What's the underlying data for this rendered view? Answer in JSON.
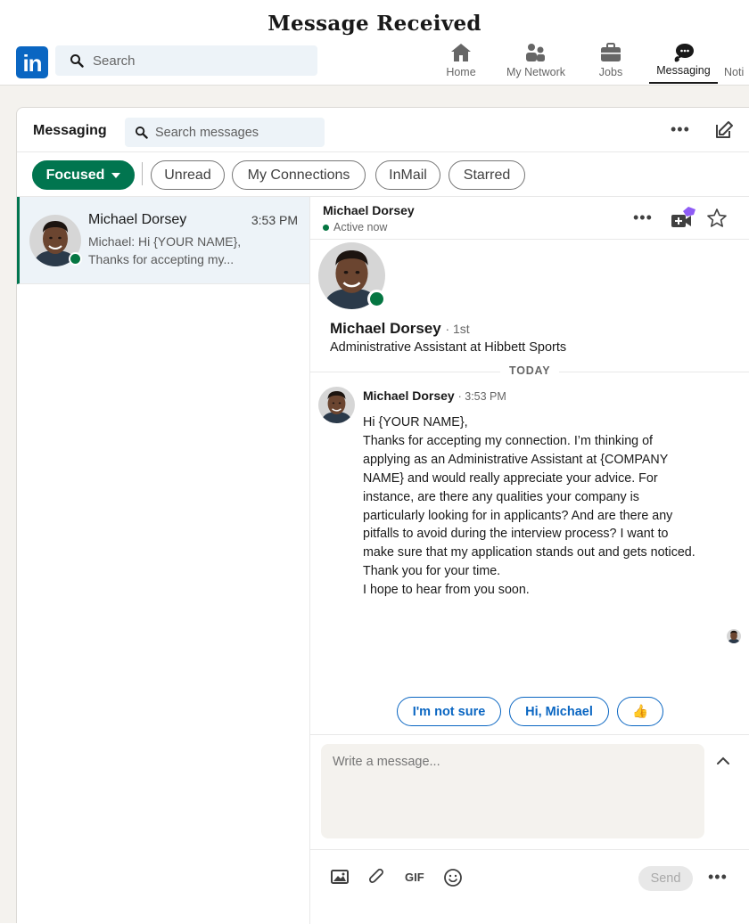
{
  "caption": "Message Received",
  "topnav": {
    "logo": "in",
    "search_placeholder": "Search",
    "items": [
      {
        "label": "Home",
        "icon": "home-icon"
      },
      {
        "label": "My Network",
        "icon": "network-icon"
      },
      {
        "label": "Jobs",
        "icon": "briefcase-icon"
      },
      {
        "label": "Messaging",
        "icon": "messaging-icon",
        "active": true
      },
      {
        "label": "Noti",
        "icon": "bell-icon"
      }
    ]
  },
  "messaging": {
    "title": "Messaging",
    "search_placeholder": "Search messages",
    "more": "•••",
    "filters": [
      "Focused",
      "Unread",
      "My Connections",
      "InMail",
      "Starred"
    ]
  },
  "conversation": {
    "name": "Michael Dorsey",
    "time": "3:53 PM",
    "preview": "Michael: Hi {YOUR NAME}, Thanks for accepting my..."
  },
  "thread": {
    "name": "Michael Dorsey",
    "status": "Active now",
    "more": "•••",
    "profile_name": "Michael Dorsey",
    "degree": "· 1st",
    "headline": "Administrative Assistant at Hibbett Sports",
    "day_label": "TODAY",
    "sender": "Michael Dorsey",
    "sent_time": "· 3:53 PM",
    "message_lines": [
      "Hi {YOUR NAME},",
      "Thanks for accepting my connection. I’m thinking of applying as an Administrative Assistant at {COMPANY NAME} and would really appreciate your advice. For instance, are there any qualities your company is particularly looking for in applicants? And are there any pitfalls to avoid during the interview process? I want to make sure that my application stands out and gets noticed.",
      "Thank you for your time.",
      "I hope to hear from you soon."
    ],
    "quick_replies": [
      "I'm not sure",
      "Hi, Michael",
      "👍"
    ]
  },
  "composer": {
    "placeholder": "Write a message...",
    "gif": "GIF",
    "send": "Send",
    "more": "•••"
  },
  "colors": {
    "linkedin_blue": "#0a66c2",
    "focused_green": "#01754f",
    "online_green": "#057642",
    "premium_purple": "#8f5cf5"
  }
}
